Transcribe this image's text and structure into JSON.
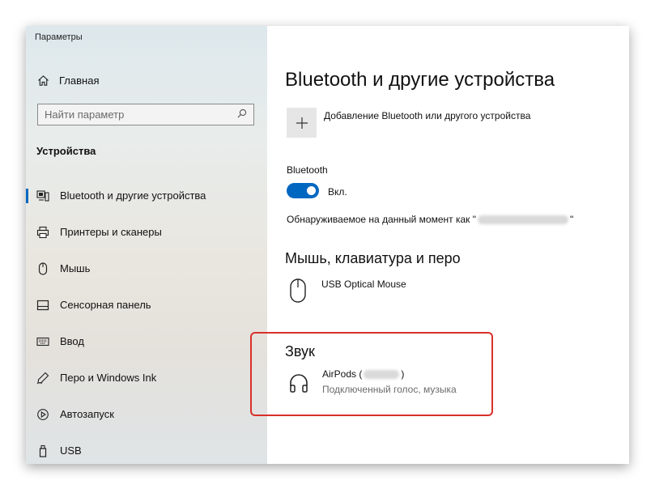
{
  "app": {
    "title": "Параметры"
  },
  "sidebar": {
    "home_label": "Главная",
    "search_placeholder": "Найти параметр",
    "section_title": "Устройства",
    "items": [
      {
        "label": "Bluetooth и другие устройства",
        "icon": "bluetooth-devices-icon",
        "active": true
      },
      {
        "label": "Принтеры и сканеры",
        "icon": "printer-icon"
      },
      {
        "label": "Мышь",
        "icon": "mouse-icon"
      },
      {
        "label": "Сенсорная панель",
        "icon": "touchpad-icon"
      },
      {
        "label": "Ввод",
        "icon": "keyboard-icon"
      },
      {
        "label": "Перо и Windows Ink",
        "icon": "pen-icon"
      },
      {
        "label": "Автозапуск",
        "icon": "autoplay-icon"
      },
      {
        "label": "USB",
        "icon": "usb-icon"
      }
    ]
  },
  "main": {
    "title": "Bluetooth и другие устройства",
    "add_device_label": "Добавление Bluetooth или другого устройства",
    "bluetooth_label": "Bluetooth",
    "toggle_state": "Вкл.",
    "discoverable_prefix": "Обнаруживаемое на данный момент как \"",
    "discoverable_suffix": "\"",
    "mouse_section_title": "Мышь, клавиатура и перо",
    "mouse_device": "USB Optical Mouse",
    "sound_section_title": "Звук",
    "sound_device_prefix": "AirPods (",
    "sound_device_suffix": ")",
    "sound_device_status": "Подключенный голос, музыка"
  },
  "colors": {
    "accent": "#0067c0",
    "highlight": "#d9302a"
  }
}
